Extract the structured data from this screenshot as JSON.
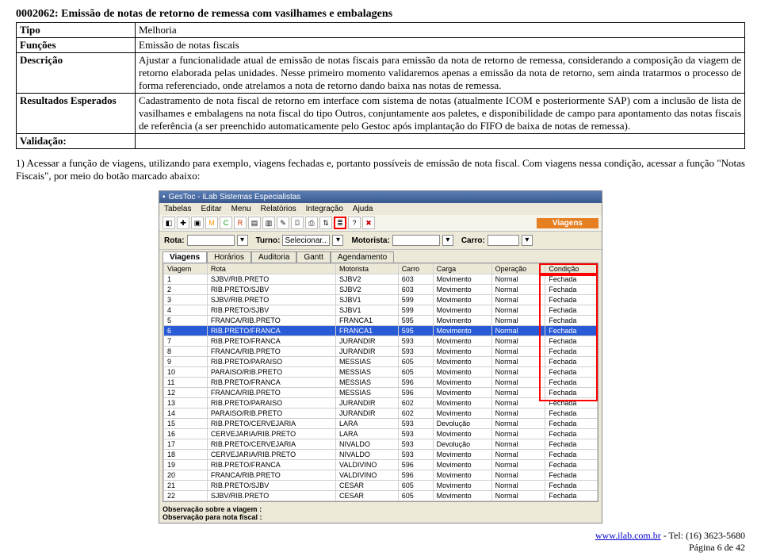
{
  "doc": {
    "title": "0002062: Emissão de notas de retorno de remessa com vasilhames e embalagens",
    "rows": {
      "tipo_label": "Tipo",
      "tipo_value": "Melhoria",
      "funcoes_label": "Funções",
      "funcoes_value": "Emissão de notas fiscais",
      "descricao_label": "Descrição",
      "descricao_value": "Ajustar a funcionalidade atual de emissão de notas fiscais para emissão da nota de retorno de remessa, considerando a composição da viagem de retorno elaborada pelas unidades. Nesse primeiro momento validaremos apenas a emissão da nota de retorno, sem ainda tratarmos o processo de forma referenciado, onde atrelamos a nota de retorno dando baixa nas notas de remessa.",
      "resultados_label": "Resultados Esperados",
      "resultados_value": "Cadastramento de nota fiscal de retorno em interface com sistema de notas (atualmente ICOM e posteriormente SAP) com a inclusão de lista de vasilhames e embalagens na nota fiscal do tipo Outros, conjuntamente aos paletes, e disponibilidade de campo para apontamento das notas fiscais de referência (a ser preenchido automaticamente pelo Gestoc após implantação do FIFO de baixa de notas de remessa).",
      "validacao_label": "Validação:"
    },
    "validation_text": "1) Acessar a função de viagens, utilizando para exemplo, viagens fechadas e, portanto possíveis de emissão de nota fiscal. Com viagens nessa condição, acessar a função \"Notas Fiscais\", por meio do botão marcado abaixo:"
  },
  "app": {
    "title": "GesToc - iLab Sistemas Especialistas",
    "menu": [
      "Tabelas",
      "Editar",
      "Menu",
      "Relatórios",
      "Integração",
      "Ajuda"
    ],
    "toolbar_label": "Viagens",
    "filter": {
      "rota_label": "Rota:",
      "rota_value": "",
      "turno_label": "Turno:",
      "turno_value": "Selecionar...",
      "motorista_label": "Motorista:",
      "motorista_value": "",
      "carro_label": "Carro:",
      "carro_value": ""
    },
    "tabs": [
      "Viagens",
      "Horários",
      "Auditoria",
      "Gantt",
      "Agendamento"
    ],
    "grid": {
      "headers": [
        "Viagem",
        "Rota",
        "Motorista",
        "Carro",
        "Carga",
        "Operação",
        "Condição"
      ],
      "rows": [
        [
          "1",
          "SJBV/RIB.PRETO",
          "SJBV2",
          "603",
          "Movimento",
          "Normal",
          "Fechada"
        ],
        [
          "2",
          "RIB.PRETO/SJBV",
          "SJBV2",
          "603",
          "Movimento",
          "Normal",
          "Fechada"
        ],
        [
          "3",
          "SJBV/RIB.PRETO",
          "SJBV1",
          "599",
          "Movimento",
          "Normal",
          "Fechada"
        ],
        [
          "4",
          "RIB.PRETO/SJBV",
          "SJBV1",
          "599",
          "Movimento",
          "Normal",
          "Fechada"
        ],
        [
          "5",
          "FRANCA/RIB.PRETO",
          "FRANCA1",
          "595",
          "Movimento",
          "Normal",
          "Fechada"
        ],
        [
          "6",
          "RIB.PRETO/FRANCA",
          "FRANCA1",
          "595",
          "Movimento",
          "Normal",
          "Fechada"
        ],
        [
          "7",
          "RIB.PRETO/FRANCA",
          "JURANDIR",
          "593",
          "Movimento",
          "Normal",
          "Fechada"
        ],
        [
          "8",
          "FRANCA/RIB.PRETO",
          "JURANDIR",
          "593",
          "Movimento",
          "Normal",
          "Fechada"
        ],
        [
          "9",
          "RIB.PRETO/PARAISO",
          "MESSIAS",
          "605",
          "Movimento",
          "Normal",
          "Fechada"
        ],
        [
          "10",
          "PARAISO/RIB.PRETO",
          "MESSIAS",
          "605",
          "Movimento",
          "Normal",
          "Fechada"
        ],
        [
          "11",
          "RIB.PRETO/FRANCA",
          "MESSIAS",
          "596",
          "Movimento",
          "Normal",
          "Fechada"
        ],
        [
          "12",
          "FRANCA/RIB.PRETO",
          "MESSIAS",
          "596",
          "Movimento",
          "Normal",
          "Fechada"
        ],
        [
          "13",
          "RIB.PRETO/PARAISO",
          "JURANDIR",
          "602",
          "Movimento",
          "Normal",
          "Fechada"
        ],
        [
          "14",
          "PARAISO/RIB.PRETO",
          "JURANDIR",
          "602",
          "Movimento",
          "Normal",
          "Fechada"
        ],
        [
          "15",
          "RIB.PRETO/CERVEJARIA",
          "LARA",
          "593",
          "Devolução",
          "Normal",
          "Fechada"
        ],
        [
          "16",
          "CERVEJARIA/RIB.PRETO",
          "LARA",
          "593",
          "Movimento",
          "Normal",
          "Fechada"
        ],
        [
          "17",
          "RIB.PRETO/CERVEJARIA",
          "NIVALDO",
          "593",
          "Devolução",
          "Normal",
          "Fechada"
        ],
        [
          "18",
          "CERVEJARIA/RIB.PRETO",
          "NIVALDO",
          "593",
          "Movimento",
          "Normal",
          "Fechada"
        ],
        [
          "19",
          "RIB.PRETO/FRANCA",
          "VALDIVINO",
          "596",
          "Movimento",
          "Normal",
          "Fechada"
        ],
        [
          "20",
          "FRANCA/RIB.PRETO",
          "VALDIVINO",
          "596",
          "Movimento",
          "Normal",
          "Fechada"
        ],
        [
          "21",
          "RIB.PRETO/SJBV",
          "CESAR",
          "605",
          "Movimento",
          "Normal",
          "Fechada"
        ],
        [
          "22",
          "SJBV/RIB.PRETO",
          "CESAR",
          "605",
          "Movimento",
          "Normal",
          "Fechada"
        ]
      ],
      "selected_index": 5
    },
    "obs1": "Observação sobre a viagem :",
    "obs2": "Observação para nota fiscal :"
  },
  "footer": {
    "link_text": "www.ilab.com.br",
    "phone": " - Tel: (16) 3623-5680",
    "page": "Página 6 de 42"
  }
}
